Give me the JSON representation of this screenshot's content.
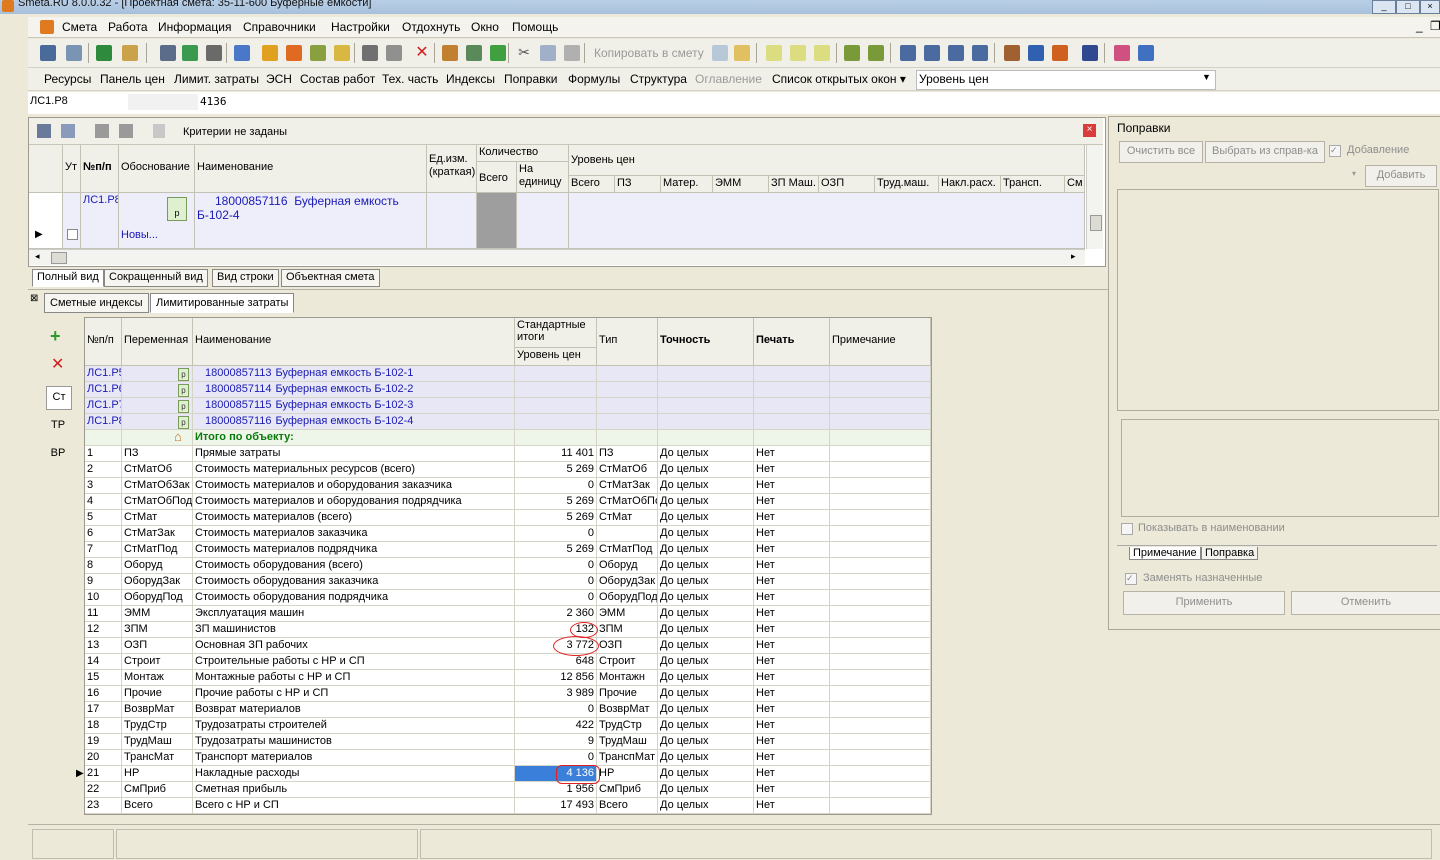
{
  "window": {
    "title": "Smeta.RU  8.0.0.32  - [Проектная смета: 35-11-600  Буферные емкости]"
  },
  "menu": [
    "Смета",
    "Работа",
    "Информация",
    "Справочники",
    "Настройки",
    "Отдохнуть",
    "Окно",
    "Помощь"
  ],
  "toolbar": {
    "copy_label": "Копировать в смету"
  },
  "tabs2": [
    {
      "label": "Ресурсы"
    },
    {
      "label": "Панель цен"
    },
    {
      "label": "Лимит. затраты"
    },
    {
      "label": "ЭСН"
    },
    {
      "label": "Состав работ"
    },
    {
      "label": "Тех. часть"
    },
    {
      "label": "Индексы"
    },
    {
      "label": "Поправки"
    },
    {
      "label": "Формулы"
    },
    {
      "label": "Структура"
    },
    {
      "label": "Оглавление",
      "disabled": true
    },
    {
      "label": "Список открытых окон ▾"
    },
    {
      "label": "Уровень цен"
    }
  ],
  "address": {
    "ref": "ЛС1.Р8",
    "value": "4136"
  },
  "upper": {
    "criteria": "Критерии не заданы",
    "headers": {
      "ut": "Ут",
      "num": "№п/п",
      "basis": "Обоснование",
      "name": "Наименование",
      "unit": "Ед.изм. (краткая)",
      "qty": "Количество",
      "qty_total": "Всего",
      "qty_per": "На единицу",
      "level": "Уровень цен",
      "cols": [
        "Всего",
        "ПЗ",
        "Матер.",
        "ЭММ",
        "ЗП Маш.",
        "ОЗП",
        "Труд.маш.",
        "Накл.расх.",
        "Трансп.",
        "См"
      ]
    },
    "row": {
      "num": "ЛС1.Р8",
      "code": "18000857116",
      "name": "Буферная емкость Б-102-4",
      "note": "Новы..."
    }
  },
  "view_tabs": [
    "Полный вид",
    "Сокращенный вид",
    "Вид строки",
    "Объектная смета"
  ],
  "lower_tabs": [
    "Сметные индексы",
    "Лимитированные затраты"
  ],
  "side": [
    "Ст",
    "ТР",
    "ВР"
  ],
  "grid": {
    "headers": {
      "num": "№п/п",
      "var": "Переменная",
      "name": "Наименование",
      "std": "Стандартные итоги",
      "level": "Уровень цен",
      "type": "Тип",
      "acc": "Точность",
      "print": "Печать",
      "note": "Примечание"
    },
    "objects": [
      {
        "ref": "ЛС1.Р5",
        "code": "18000857113",
        "name": "Буферная емкость Б-102-1"
      },
      {
        "ref": "ЛС1.Р6",
        "code": "18000857114",
        "name": "Буферная емкость Б-102-2"
      },
      {
        "ref": "ЛС1.Р7",
        "code": "18000857115",
        "name": "Буферная емкость Б-102-3"
      },
      {
        "ref": "ЛС1.Р8",
        "code": "18000857116",
        "name": "Буферная емкость Б-102-4"
      }
    ],
    "total_label": "Итого по объекту:",
    "rows": [
      {
        "n": "1",
        "v": "ПЗ",
        "name": "Прямые затраты",
        "val": "11 401",
        "type": "ПЗ",
        "acc": "До целых",
        "print": "Нет"
      },
      {
        "n": "2",
        "v": "СтМатОб",
        "name": "Стоимость материальных ресурсов (всего)",
        "val": "5 269",
        "type": "СтМатОб",
        "acc": "До целых",
        "print": "Нет"
      },
      {
        "n": "3",
        "v": "СтМатОбЗак",
        "name": "Стоимость материалов и оборудования заказчика",
        "val": "0",
        "type": "СтМатЗак",
        "acc": "До целых",
        "print": "Нет"
      },
      {
        "n": "4",
        "v": "СтМатОбПод",
        "name": "Стоимость материалов и оборудования подрядчика",
        "val": "5 269",
        "type": "СтМатОбПо",
        "acc": "До целых",
        "print": "Нет"
      },
      {
        "n": "5",
        "v": "СтМат",
        "name": "Стоимость материалов (всего)",
        "val": "5 269",
        "type": "СтМат",
        "acc": "До целых",
        "print": "Нет"
      },
      {
        "n": "6",
        "v": "СтМатЗак",
        "name": "Стоимость материалов заказчика",
        "val": "0",
        "type": "",
        "acc": "До целых",
        "print": "Нет"
      },
      {
        "n": "7",
        "v": "СтМатПод",
        "name": "Стоимость материалов подрядчика",
        "val": "5 269",
        "type": "СтМатПод",
        "acc": "До целых",
        "print": "Нет"
      },
      {
        "n": "8",
        "v": "Оборуд",
        "name": "Стоимость оборудования (всего)",
        "val": "0",
        "type": "Оборуд",
        "acc": "До целых",
        "print": "Нет"
      },
      {
        "n": "9",
        "v": "ОборудЗак",
        "name": "Стоимость оборудования заказчика",
        "val": "0",
        "type": "ОборудЗак",
        "acc": "До целых",
        "print": "Нет"
      },
      {
        "n": "10",
        "v": "ОборудПод",
        "name": "Стоимость оборудования подрядчика",
        "val": "0",
        "type": "ОборудПод",
        "acc": "До целых",
        "print": "Нет"
      },
      {
        "n": "11",
        "v": "ЭММ",
        "name": "Эксплуатация машин",
        "val": "2 360",
        "type": "ЭММ",
        "acc": "До целых",
        "print": "Нет"
      },
      {
        "n": "12",
        "v": "ЗПМ",
        "name": "ЗП машинистов",
        "val": "132",
        "type": "ЗПМ",
        "acc": "До целых",
        "print": "Нет"
      },
      {
        "n": "13",
        "v": "ОЗП",
        "name": "Основная ЗП рабочих",
        "val": "3 772",
        "type": "ОЗП",
        "acc": "До целых",
        "print": "Нет"
      },
      {
        "n": "14",
        "v": "Строит",
        "name": "Строительные работы с НР и СП",
        "val": "648",
        "type": "Строит",
        "acc": "До целых",
        "print": "Нет"
      },
      {
        "n": "15",
        "v": "Монтаж",
        "name": "Монтажные работы с НР и СП",
        "val": "12 856",
        "type": "Монтажн",
        "acc": "До целых",
        "print": "Нет"
      },
      {
        "n": "16",
        "v": "Прочие",
        "name": "Прочие работы с НР и СП",
        "val": "3 989",
        "type": "Прочие",
        "acc": "До целых",
        "print": "Нет"
      },
      {
        "n": "17",
        "v": "ВозврМат",
        "name": "Возврат материалов",
        "val": "0",
        "type": "ВозврМат",
        "acc": "До целых",
        "print": "Нет"
      },
      {
        "n": "18",
        "v": "ТрудСтр",
        "name": "Трудозатраты строителей",
        "val": "422",
        "type": "ТрудСтр",
        "acc": "До целых",
        "print": "Нет"
      },
      {
        "n": "19",
        "v": "ТрудМаш",
        "name": "Трудозатраты машинистов",
        "val": "9",
        "type": "ТрудМаш",
        "acc": "До целых",
        "print": "Нет"
      },
      {
        "n": "20",
        "v": "ТрансМат",
        "name": "Транспорт материалов",
        "val": "0",
        "type": "ТранспМат",
        "acc": "До целых",
        "print": "Нет"
      },
      {
        "n": "21",
        "v": "НР",
        "name": "Накладные расходы",
        "val": "4 136",
        "type": "НР",
        "acc": "До целых",
        "print": "Нет"
      },
      {
        "n": "22",
        "v": "СмПриб",
        "name": "Сметная прибыль",
        "val": "1 956",
        "type": "СмПриб",
        "acc": "До целых",
        "print": "Нет"
      },
      {
        "n": "23",
        "v": "Всего",
        "name": "Всего с НР и СП",
        "val": "17 493",
        "type": "Всего",
        "acc": "До целых",
        "print": "Нет"
      }
    ]
  },
  "popravki": {
    "title": "Поправки",
    "clear": "Очистить все",
    "choose": "Выбрать из справ-ка",
    "add_check": "Добавление",
    "add_btn": "Добавить",
    "show_in_name": "Показывать в наименовании",
    "tab_note": "Примечание",
    "tab_corr": "Поправка",
    "replace": "Заменять назначенные",
    "apply": "Применить",
    "cancel": "Отменить"
  }
}
